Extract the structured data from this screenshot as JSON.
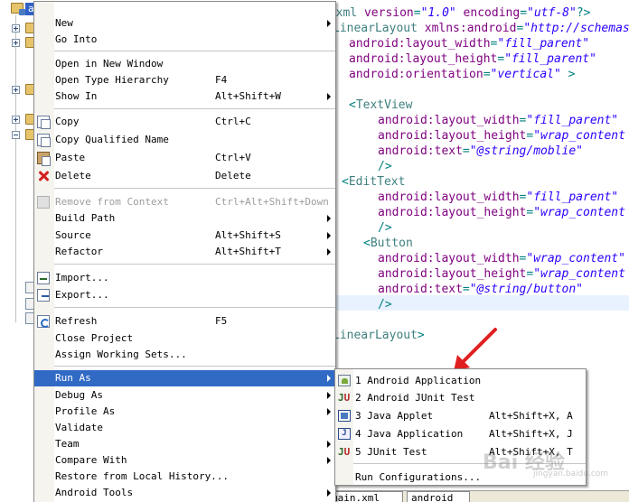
{
  "explorer": {
    "selected_project": "android"
  },
  "editor": {
    "lines": [
      [
        [
          "punct",
          "<?"
        ],
        [
          "tag",
          "xml "
        ],
        [
          "attr",
          "version"
        ],
        [
          "punct",
          "="
        ],
        [
          "val",
          "\"1.0\""
        ],
        [
          "attr",
          " encoding"
        ],
        [
          "punct",
          "="
        ],
        [
          "val",
          "\"utf-8\""
        ],
        [
          "punct",
          "?>"
        ]
      ],
      [
        [
          "tag",
          "LinearLayout "
        ],
        [
          "attr",
          "xmlns:android"
        ],
        [
          "punct",
          "="
        ],
        [
          "val",
          "\"http://schemas"
        ]
      ],
      [
        [
          "attr",
          "android:layout_width"
        ],
        [
          "punct",
          "="
        ],
        [
          "val",
          "\"fill_parent\""
        ]
      ],
      [
        [
          "attr",
          "android:layout_height"
        ],
        [
          "punct",
          "="
        ],
        [
          "val",
          "\"fill_parent\""
        ]
      ],
      [
        [
          "attr",
          "android:orientation"
        ],
        [
          "punct",
          "="
        ],
        [
          "val",
          "\"vertical\""
        ],
        [
          "punct",
          " >"
        ]
      ],
      [],
      [
        [
          "punct",
          "<"
        ],
        [
          "tag",
          "TextView"
        ]
      ],
      [
        [
          "attr",
          "android:layout_width"
        ],
        [
          "punct",
          "="
        ],
        [
          "val",
          "\"fill_parent\""
        ]
      ],
      [
        [
          "attr",
          "android:layout_height"
        ],
        [
          "punct",
          "="
        ],
        [
          "val",
          "\"wrap_content"
        ]
      ],
      [
        [
          "attr",
          "android:text"
        ],
        [
          "punct",
          "="
        ],
        [
          "val",
          "\"@string/moblie\""
        ]
      ],
      [
        [
          "punct",
          "/>"
        ]
      ],
      [
        [
          "punct",
          "<"
        ],
        [
          "tag",
          "EditText"
        ]
      ],
      [
        [
          "attr",
          "android:layout_width"
        ],
        [
          "punct",
          "="
        ],
        [
          "val",
          "\"fill_parent\""
        ]
      ],
      [
        [
          "attr",
          "android:layout_height"
        ],
        [
          "punct",
          "="
        ],
        [
          "val",
          "\"wrap_content"
        ]
      ],
      [
        [
          "punct",
          "/>"
        ]
      ],
      [
        [
          "punct",
          "<"
        ],
        [
          "tag",
          "Button"
        ]
      ],
      [
        [
          "attr",
          "android:layout_width"
        ],
        [
          "punct",
          "="
        ],
        [
          "val",
          "\"wrap_content\""
        ]
      ],
      [
        [
          "attr",
          "android:layout_height"
        ],
        [
          "punct",
          "="
        ],
        [
          "val",
          "\"wrap_content"
        ]
      ],
      [
        [
          "attr",
          "android:text"
        ],
        [
          "punct",
          "="
        ],
        [
          "val",
          "\"@string/button\""
        ]
      ],
      [
        [
          "punct",
          "/>"
        ]
      ],
      [],
      [
        [
          "tag",
          "LinearLayout"
        ],
        [
          "punct",
          ">"
        ]
      ]
    ],
    "tabs": [
      "main.xml",
      "android"
    ]
  },
  "context_menu": {
    "new": "New",
    "go_into": "Go Into",
    "open_new_window": "Open in New Window",
    "open_type_hierarchy": "Open Type Hierarchy",
    "open_type_hierarchy_key": "F4",
    "show_in": "Show In",
    "show_in_key": "Alt+Shift+W",
    "copy": "Copy",
    "copy_key": "Ctrl+C",
    "copy_qualified": "Copy Qualified Name",
    "paste": "Paste",
    "paste_key": "Ctrl+V",
    "delete": "Delete",
    "delete_key": "Delete",
    "remove_context": "Remove from Context",
    "remove_context_key": "Ctrl+Alt+Shift+Down",
    "build_path": "Build Path",
    "source": "Source",
    "source_key": "Alt+Shift+S",
    "refactor": "Refactor",
    "refactor_key": "Alt+Shift+T",
    "import": "Import...",
    "export": "Export...",
    "refresh": "Refresh",
    "refresh_key": "F5",
    "close_project": "Close Project",
    "assign_working_sets": "Assign Working Sets...",
    "run_as": "Run As",
    "debug_as": "Debug As",
    "profile_as": "Profile As",
    "validate": "Validate",
    "team": "Team",
    "compare_with": "Compare With",
    "restore_history": "Restore from Local History...",
    "android_tools": "Android Tools"
  },
  "run_as_menu": {
    "android_app": "1 Android Application",
    "android_junit": "2 Android JUnit Test",
    "java_applet": "3 Java Applet",
    "java_applet_key": "Alt+Shift+X, A",
    "java_app": "4 Java Application",
    "java_app_key": "Alt+Shift+X, J",
    "junit": "5 JUnit Test",
    "junit_key": "Alt+Shift+X, T",
    "run_configs": "Run Configurations..."
  },
  "annotation": {
    "arrow_color": "#e02020"
  },
  "watermark": {
    "text": "Bai 经验",
    "sub": "jingyan.baidu.com"
  }
}
